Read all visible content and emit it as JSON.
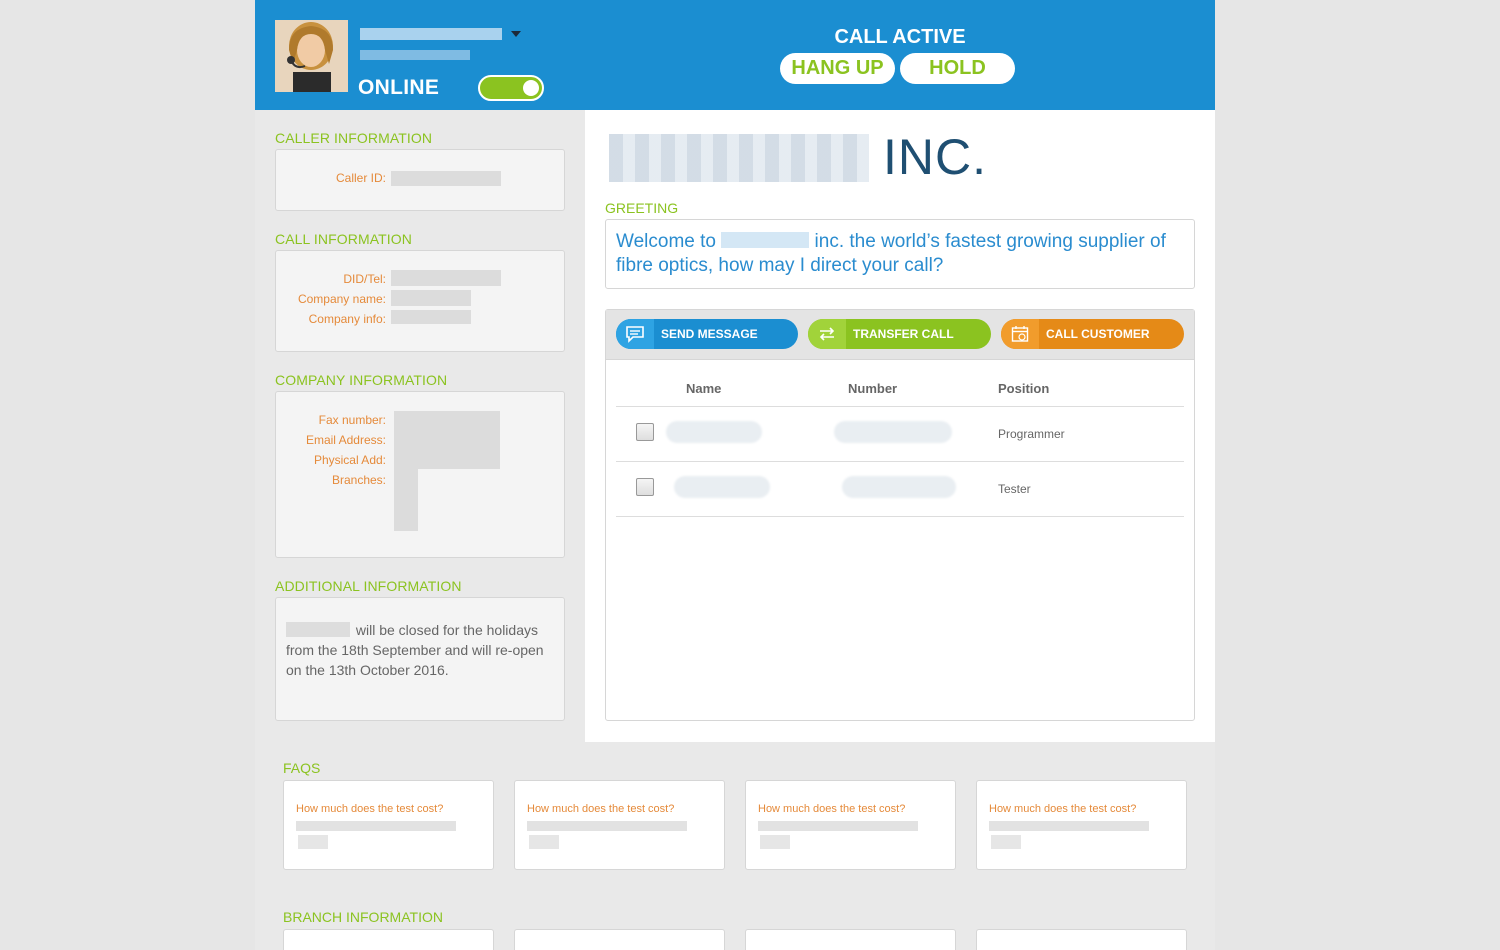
{
  "header": {
    "status_label": "ONLINE",
    "call_status": "CALL ACTIVE",
    "hangup_label": "HANG UP",
    "hold_label": "HOLD"
  },
  "caller_info": {
    "title": "CALLER INFORMATION",
    "caller_id_label": "Caller ID:"
  },
  "call_info": {
    "title": "CALL INFORMATION",
    "did_label": "DID/Tel:",
    "company_name_label": "Company name:",
    "company_info_label": "Company info:"
  },
  "company_info": {
    "title": "COMPANY INFORMATION",
    "fax_label": "Fax number:",
    "email_label": "Email Address:",
    "physical_label": "Physical Add:",
    "branches_label": "Branches:"
  },
  "additional_info": {
    "title": "ADDITIONAL INFORMATION",
    "text": "will be closed for the holidays from the 18th September and will re-open on the 13th October 2016."
  },
  "company": {
    "suffix": "INC."
  },
  "greeting": {
    "title": "GREETING",
    "text_before": "Welcome to",
    "text_after": "inc. the world’s fastest growing supplier of fibre optics, how may I direct your call?"
  },
  "actions": {
    "send_message": "SEND MESSAGE",
    "transfer_call": "TRANSFER CALL",
    "call_customer": "CALL CUSTOMER"
  },
  "contacts": {
    "headers": [
      "Name",
      "Number",
      "Position"
    ],
    "rows": [
      {
        "position": "Programmer"
      },
      {
        "position": "Tester"
      }
    ]
  },
  "faqs": {
    "title": "FAQS",
    "items": [
      "How much does the test cost?",
      "How much does the test cost?",
      "How much does the test cost?",
      "How much does the test cost?"
    ]
  },
  "branch": {
    "title": "BRANCH INFORMATION"
  },
  "colors": {
    "header_blue": "#1b8ed1",
    "accent_green": "#8bc320",
    "accent_orange": "#e58a17",
    "label_orange": "#e58a3a"
  },
  "icons": {
    "send": "chat-bubble-icon",
    "transfer": "transfer-arrows-icon",
    "call_customer": "calendar-clock-icon",
    "caret": "caret-down-icon"
  }
}
